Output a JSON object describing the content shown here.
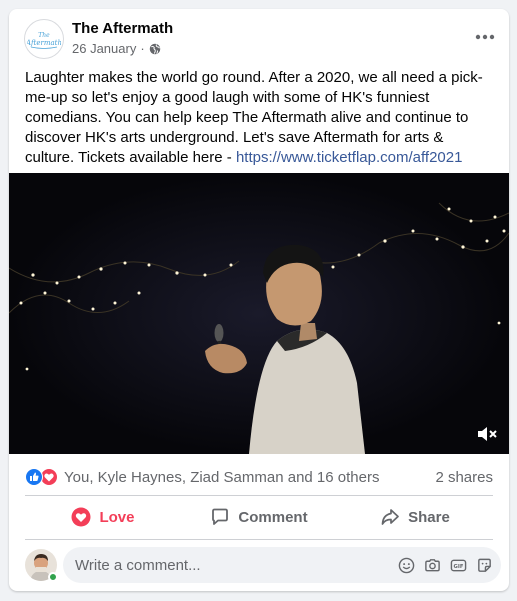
{
  "post": {
    "page_name": "The Aftermath",
    "date": "26 January",
    "dot": "·",
    "logo_text": "The Aftermath",
    "body_text": "Laughter makes the world go round. After a 2020, we all need a pick-me-up so let's enjoy a good laugh with some of HK's funniest comedians. You can help keep The Aftermath alive and continue to discover HK's arts underground. Let's save Aftermath for arts & culture. Tickets available here - ",
    "link_text": "https://www.ticketflap.com/aff2021"
  },
  "reactions": {
    "names": "You, Kyle Haynes, Ziad Samman and 16 others",
    "shares": "2 shares",
    "icons": [
      "like-icon",
      "love-icon"
    ]
  },
  "actions": {
    "love_label": "Love",
    "comment_label": "Comment",
    "share_label": "Share"
  },
  "comment": {
    "placeholder": "Write a comment...",
    "icons": [
      "emoji-icon",
      "camera-icon",
      "gif-icon",
      "sticker-icon"
    ]
  },
  "colors": {
    "love": "#f33e58",
    "like": "#1877f2",
    "link": "#385898",
    "muted": "#65676b",
    "online": "#31a24c"
  }
}
